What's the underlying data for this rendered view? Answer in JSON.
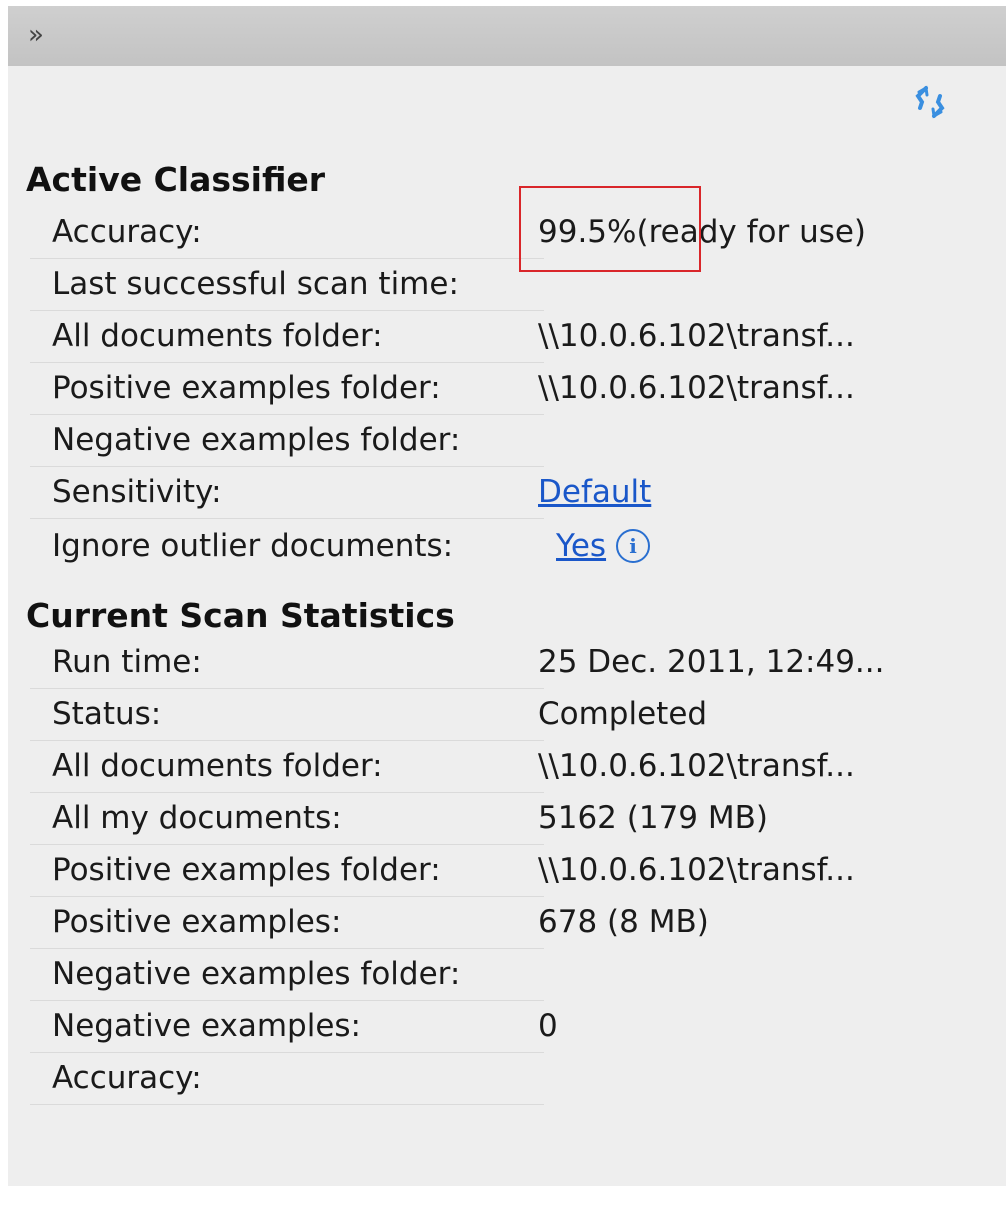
{
  "topbar": {
    "expand_glyph": "»",
    "icon": "double-chevron-right-icon"
  },
  "refresh": {
    "icon": "refresh-icon"
  },
  "active_classifier": {
    "title": "Active Classifier",
    "rows": [
      {
        "label": "Accuracy:",
        "value": "99.5%(ready for use)"
      },
      {
        "label": "Last successful scan time:",
        "value": ""
      },
      {
        "label": "All documents folder:",
        "value": "\\\\10.0.6.102\\transf..."
      },
      {
        "label": "Positive examples folder:",
        "value": "\\\\10.0.6.102\\transf..."
      },
      {
        "label": "Negative examples folder:",
        "value": ""
      },
      {
        "label": "Sensitivity:",
        "value": "Default"
      },
      {
        "label": "Ignore outlier documents:",
        "value": "Yes"
      }
    ]
  },
  "info_icon_glyph": "i",
  "scan_stats": {
    "title": "Current Scan Statistics",
    "rows": [
      {
        "label": "Run time:",
        "value": "25 Dec. 2011, 12:49..."
      },
      {
        "label": "Status:",
        "value": "Completed"
      },
      {
        "label": "All documents folder:",
        "value": "\\\\10.0.6.102\\transf..."
      },
      {
        "label": "All my documents:",
        "value": "5162 (179 MB)"
      },
      {
        "label": "Positive examples folder:",
        "value": "\\\\10.0.6.102\\transf..."
      },
      {
        "label": "Positive examples:",
        "value": "678 (8 MB)"
      },
      {
        "label": "Negative examples folder:",
        "value": ""
      },
      {
        "label": "Negative examples:",
        "value": "0"
      },
      {
        "label": "Accuracy:",
        "value": ""
      }
    ]
  },
  "colors": {
    "link": "#1a57c9",
    "highlight": "#d9262a",
    "panel_bg": "#eeeeee"
  }
}
